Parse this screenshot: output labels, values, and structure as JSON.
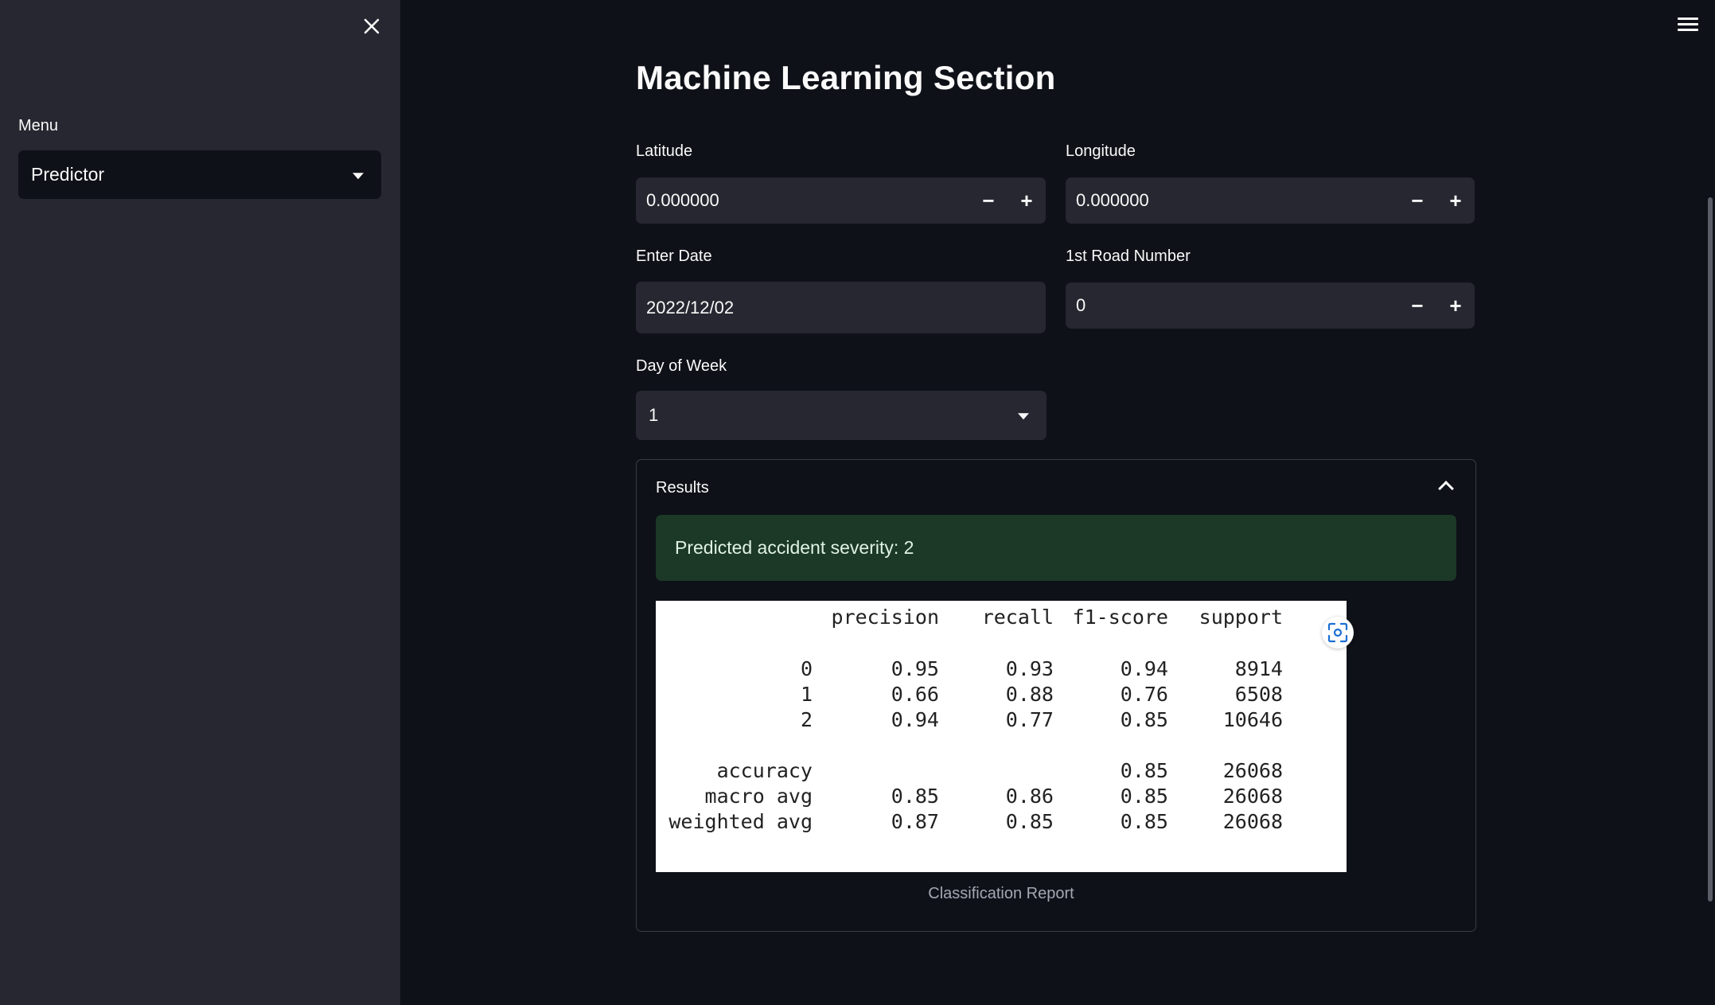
{
  "sidebar": {
    "menu_label": "Menu",
    "menu_selected": "Predictor"
  },
  "main": {
    "title": "Machine Learning Section",
    "latitude": {
      "label": "Latitude",
      "value": "0.000000"
    },
    "longitude": {
      "label": "Longitude",
      "value": "0.000000"
    },
    "date": {
      "label": "Enter Date",
      "value": "2022/12/02"
    },
    "road": {
      "label": "1st Road Number",
      "value": "0"
    },
    "day": {
      "label": "Day of Week",
      "value": "1"
    },
    "stepper": {
      "minus": "−",
      "plus": "+"
    }
  },
  "results": {
    "title": "Results",
    "prediction": "Predicted accident severity: 2",
    "caption": "Classification Report",
    "report": {
      "headers": [
        "precision",
        "recall",
        "f1-score",
        "support"
      ],
      "rows": [
        [
          "0",
          "0.95",
          "0.93",
          "0.94",
          "8914"
        ],
        [
          "1",
          "0.66",
          "0.88",
          "0.76",
          "6508"
        ],
        [
          "2",
          "0.94",
          "0.77",
          "0.85",
          "10646"
        ],
        [
          "accuracy",
          "",
          "",
          "0.85",
          "26068"
        ],
        [
          "macro avg",
          "0.85",
          "0.86",
          "0.85",
          "26068"
        ],
        [
          "weighted avg",
          "0.87",
          "0.85",
          "0.85",
          "26068"
        ]
      ]
    }
  },
  "icons": {
    "close": "close-icon",
    "menu": "hamburger-icon",
    "fullscreen": "fullscreen-icon",
    "collapse": "chevron-up-icon"
  },
  "colors": {
    "background": "#0e1117",
    "sidebar": "#262730",
    "success": "#1c3827"
  }
}
